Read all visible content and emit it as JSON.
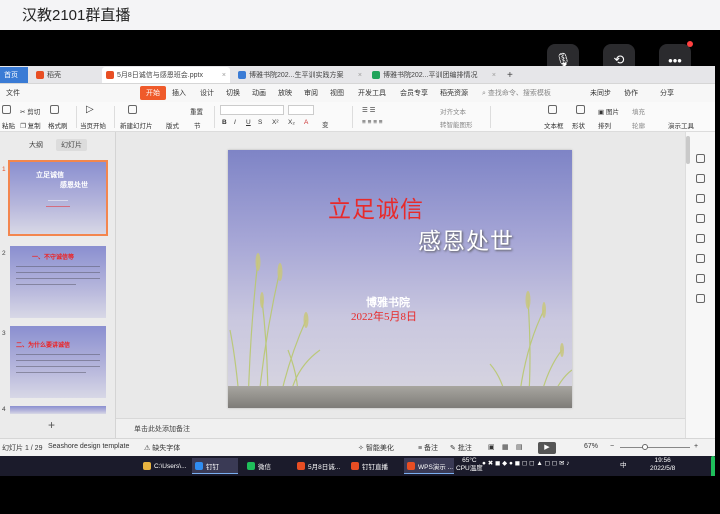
{
  "live": {
    "title": "汉教2101群直播"
  },
  "overlay": {
    "buttons": [
      {
        "icon": "mic-off-icon",
        "glyph": "🎙"
      },
      {
        "icon": "rotate-icon",
        "glyph": "⟲"
      },
      {
        "icon": "more-icon",
        "glyph": "•••"
      }
    ],
    "notify_color": "#ff4040"
  },
  "wps": {
    "tabs": [
      {
        "label": "首页",
        "color": "#3a7bd5"
      },
      {
        "label": "稻壳",
        "color": "#e84e23"
      },
      {
        "label": "5月8日诚信与感恩班会.pptx",
        "color": "#e84e23"
      },
      {
        "label": "博雅书院202...生平训实践方案",
        "color": "#3a7bd5"
      },
      {
        "label": "博雅书院202...平训团编排情况",
        "color": "#1fa35a"
      }
    ],
    "add_tab": "+",
    "menu": [
      "文件",
      "开始",
      "插入",
      "设计",
      "切换",
      "动画",
      "放映",
      "审阅",
      "视图",
      "开发工具",
      "会员专享",
      "稻壳资源"
    ],
    "search_placeholder": "查找命令、搜索模板",
    "menu_right": [
      "未同步",
      "协作",
      "分享"
    ],
    "ribbon": {
      "cut": "剪切",
      "copy": "复制",
      "paste": "粘贴",
      "format_painter": "格式刷",
      "from_current": "当页开始",
      "new_slide": "新建幻灯片",
      "layout": "版式",
      "section": "节",
      "reset": "重置",
      "text_direction": "对齐文本",
      "smart_art": "转智能图形",
      "textbox": "文本框",
      "shape": "形状",
      "arrange": "排列",
      "picture": "图片",
      "fill": "填充",
      "outline": "轮廓",
      "present": "演示工具"
    },
    "panel_tabs": [
      "大纲",
      "幻灯片"
    ],
    "thumbs": [
      {
        "num": "1",
        "title": "立足诚信",
        "subtitle": "感恩处世"
      },
      {
        "num": "2",
        "title": "一、不守诚信等"
      },
      {
        "num": "3",
        "title": "二、为什么要讲诚信"
      },
      {
        "num": "4"
      }
    ],
    "slide": {
      "title": "立足诚信",
      "subtitle": "感恩处世",
      "org": "博雅书院",
      "date": "2022年5月8日"
    },
    "notes_placeholder": "单击此处添加备注",
    "status": {
      "slide_count": "幻灯片 1 / 29",
      "theme": "Seashore design template",
      "missing_fonts": "缺失字体",
      "smart_beautify": "智能美化",
      "notes": "备注",
      "comment": "批注",
      "zoom": "67%"
    }
  },
  "taskbar": {
    "items": [
      {
        "label": "C:\\Users\\...",
        "color": "#e8b340"
      },
      {
        "label": "钉钉",
        "color": "#2f8cf0"
      },
      {
        "label": "微信",
        "color": "#1fbf5a"
      },
      {
        "label": "5月8日诚...",
        "color": "#e84e23"
      },
      {
        "label": "钉钉直播",
        "color": "#e84e23"
      },
      {
        "label": "WPS演示 ...",
        "color": "#e84e23"
      }
    ],
    "weather_temp": "65°C",
    "weather_label": "CPU温度",
    "ime": "中",
    "time": "19:56",
    "date": "2022/5/8"
  }
}
